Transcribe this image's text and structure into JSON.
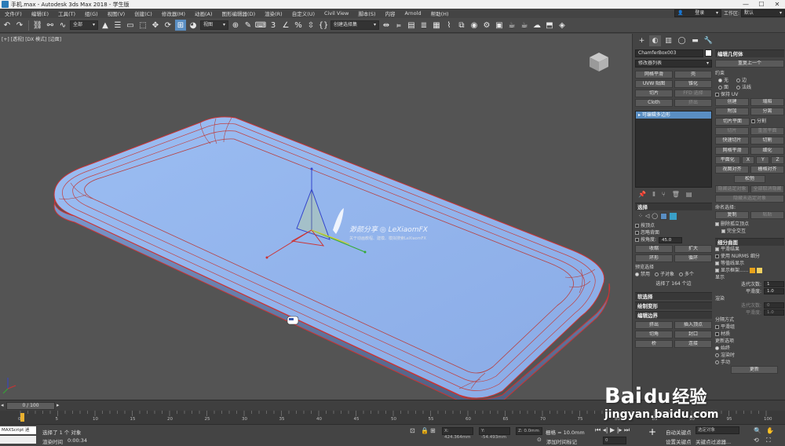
{
  "window": {
    "title": "手机.max - Autodesk 3ds Max 2018 - 学生版",
    "controls": [
      "—",
      "☐",
      "✕"
    ]
  },
  "menu": {
    "items": [
      "文件(F)",
      "编辑(E)",
      "工具(T)",
      "组(G)",
      "视图(V)",
      "创建(C)",
      "修改器(M)",
      "动画(A)",
      "图形编辑器(D)",
      "渲染(R)",
      "自定义(U)",
      "Civil View",
      "脚本(S)",
      "内容",
      "Arnold",
      "帮助(H)"
    ],
    "login": "登录",
    "workspace_label": "工作区:",
    "workspace_value": "默认"
  },
  "toolbar": {
    "filter": "全部",
    "ref_coord": "视图",
    "named_selection": "创建选择集"
  },
  "viewport": {
    "label": "[+] [透视] [DX 模式] [边面]",
    "watermark_title": "渺颜分享 ◎ LeXiaomFX",
    "watermark_sub": "关于动画教程、建模、模拟搜索LeXiaomFX"
  },
  "command_panel": {
    "object_name": "ChamferBox003",
    "modifier_list": "修改器列表",
    "modifier_buttons": [
      [
        "网格平滑",
        "壳"
      ],
      [
        "UVW 贴图",
        "锥化"
      ],
      [
        "切片",
        "FFD 选择"
      ],
      [
        "Cloth",
        "挤出"
      ]
    ],
    "stack_item": "可编辑多边形",
    "selection": {
      "title": "选择",
      "by_vertex": "按顶点",
      "ignore_backfacing": "忽略背面",
      "by_angle": "按角度:",
      "angle_value": "45.0",
      "shrink": "收缩",
      "grow": "扩大",
      "ring": "环形",
      "loop": "循环",
      "preview_label": "预览选择",
      "preview_off": "禁用",
      "preview_subobj": "子对象",
      "preview_multi": "多个",
      "status": "选择了 164 个边"
    },
    "soft_selection": "软选择",
    "paint_deformation": "绘制变形",
    "edit_edges": {
      "title": "编辑边界",
      "extrude": "挤出",
      "insert_vertex": "插入顶点",
      "chamfer": "切角",
      "cap": "封口",
      "bridge": "桥",
      "connect": "连接"
    },
    "edit_geometry": {
      "title": "编辑几何体",
      "repeat_last": "重复上一个",
      "constraints": "约束",
      "c_none": "无",
      "c_edge": "边",
      "c_face": "面",
      "c_normal": "法线",
      "preserve_uv": "保持 UV",
      "create": "创建",
      "collapse": "塌陷",
      "attach": "附加",
      "detach": "分离",
      "slice_plane": "切片平面",
      "split": "分割",
      "slice": "切片",
      "reset_plane": "重置平面",
      "quickslice": "快速切片",
      "cut": "切割",
      "meshsmooth": "网格平滑",
      "tessellate": "细化",
      "make_planar": "平面化",
      "x": "X",
      "y": "Y",
      "z": "Z",
      "view_align": "视图对齐",
      "grid_align": "栅格对齐",
      "relax": "松弛",
      "hide_selected": "隐藏选定对象",
      "unhide_all": "全部取消隐藏",
      "hide_unselected": "隐藏未选定对象",
      "named_sel": "命名选择:",
      "copy": "复制",
      "paste": "粘贴",
      "delete_isolated": "删除孤立顶点",
      "full_interactivity": "完全交互"
    },
    "subdivision_surface": {
      "title": "细分曲面",
      "smooth_result": "平滑结果",
      "use_nurms": "使用 NURMS 细分",
      "isoline_display": "等值线显示",
      "show_cage": "显示框架......",
      "display": "显示",
      "iterations": "迭代次数:",
      "iterations_value": "1",
      "smoothness": "平滑度:",
      "smoothness_value": "1.0",
      "render": "渲染",
      "r_iterations": "迭代次数:",
      "r_iterations_value": "0",
      "r_smoothness": "平滑度:",
      "r_smoothness_value": "1.0",
      "separate_by": "分隔方式",
      "smoothing_groups": "平滑组",
      "materials": "材质",
      "update_options": "更新选项",
      "always": "始终",
      "when_rendering": "渲染时",
      "manually": "手动",
      "update_btn": "更新"
    }
  },
  "timeline": {
    "position": "0 / 100",
    "ticks": [
      "0",
      "5",
      "10",
      "15",
      "20",
      "25",
      "30",
      "35",
      "40",
      "45",
      "50",
      "55",
      "60",
      "65",
      "70",
      "75",
      "80",
      "85",
      "90",
      "95",
      "100"
    ]
  },
  "status": {
    "maxscript": "MAXScript 迷",
    "selected": "选择了 1 个 对象",
    "render_time_label": "渲染时间",
    "render_time": "0:00:34",
    "x_value": "X: 424.364mm",
    "y_value": "Y: -54.493mm",
    "z_value": "Z: 0.0mm",
    "grid": "栅格 = 10.0mm",
    "add_time_tag": "添加时间标记",
    "auto_key": "自动关键点",
    "set_key": "设置关键点",
    "selected_object": "选定对象",
    "key_filters": "关键点过滤器...",
    "frame": "0"
  },
  "overlay": {
    "brand": "Bai",
    "brand_paw": "du",
    "brand_cn": "经验",
    "url": "jingyan.baidu.com"
  },
  "colors": {
    "model_face": "#8fb3ec",
    "model_edge": "#cc3333",
    "ui_accent": "#5a8ec2"
  }
}
